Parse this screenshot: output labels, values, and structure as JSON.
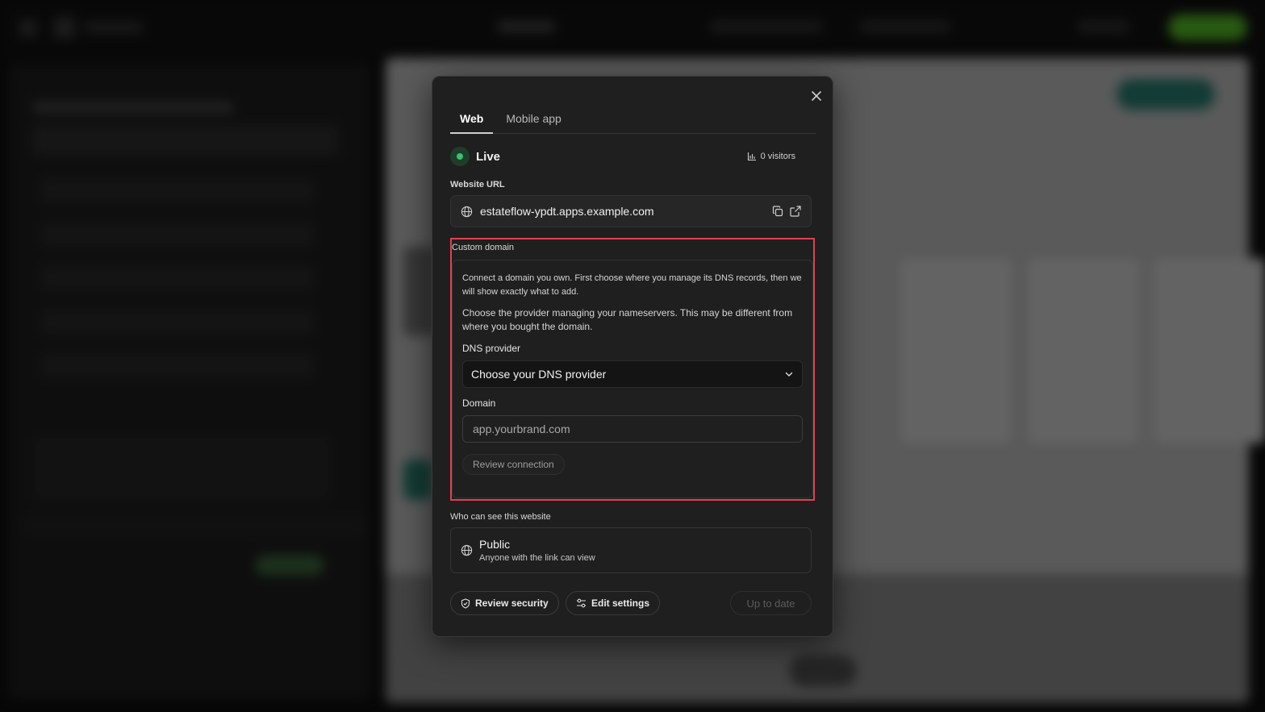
{
  "modal": {
    "tabs": [
      {
        "label": "Web",
        "active": true
      },
      {
        "label": "Mobile app",
        "active": false
      }
    ],
    "status": {
      "label": "Live",
      "color": "#38c26a",
      "visitors": "0 visitors"
    },
    "website_url": {
      "label": "Website URL",
      "value": "estateflow-ypdt.apps.example.com"
    },
    "custom_domain": {
      "label": "Custom domain",
      "intro": "Connect a domain you own. First choose where you manage its DNS records, then we will show exactly what to add.",
      "provider_hint": "Choose the provider managing your nameservers. This may be different from where you bought the domain.",
      "dns_label": "DNS provider",
      "dns_select_value": "Choose your DNS provider",
      "domain_label": "Domain",
      "domain_placeholder": "app.yourbrand.com",
      "review_button": "Review connection",
      "highlight_color": "#e0414f"
    },
    "visibility": {
      "label": "Who can see this website",
      "title": "Public",
      "subtitle": "Anyone with the link can view"
    },
    "buttons": {
      "review_security": "Review security",
      "edit_settings": "Edit settings",
      "up_to_date": "Up to date"
    }
  }
}
